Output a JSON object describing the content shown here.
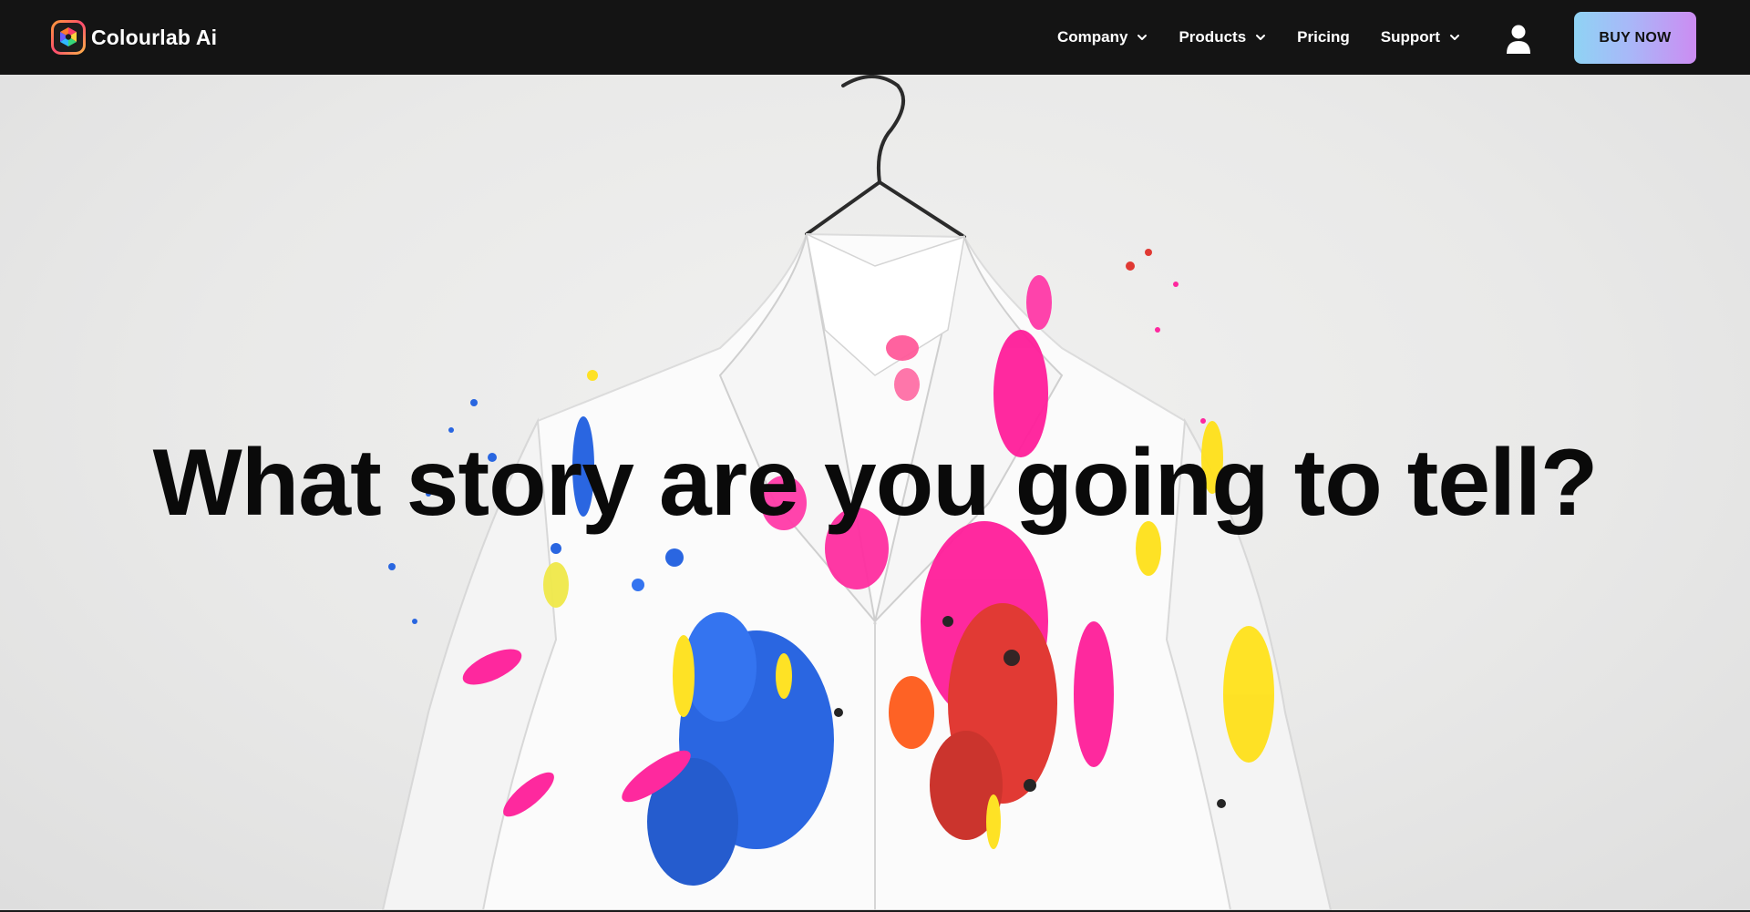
{
  "brand": {
    "name": "Colourlab Ai",
    "logo_icon": "colourlab-hexagon-logo-icon"
  },
  "nav": {
    "items": [
      {
        "label": "Company",
        "has_dropdown": true
      },
      {
        "label": "Products",
        "has_dropdown": true
      },
      {
        "label": "Pricing",
        "has_dropdown": false
      },
      {
        "label": "Support",
        "has_dropdown": true
      }
    ],
    "account_icon": "user-icon",
    "cta_label": "BUY NOW"
  },
  "hero": {
    "headline": "What story are you going to tell?",
    "image": "paint-splattered-white-shirt-on-hanger"
  },
  "colors": {
    "nav_background": "#141414",
    "cta_gradient_start": "#8fd3f4",
    "cta_gradient_end": "#cc8cf2",
    "headline": "#0a0a0a",
    "splash_pink": "#ff1e9a",
    "splash_blue": "#1f5fe0",
    "splash_yellow": "#ffe11a",
    "splash_red": "#e0302a"
  }
}
